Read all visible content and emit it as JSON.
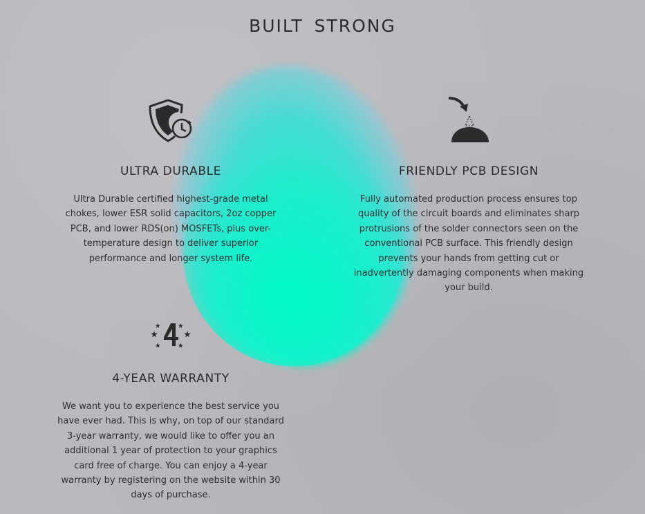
{
  "page": {
    "title": "BUILT STRONG",
    "accent_color": "#00f5c5"
  },
  "features": [
    {
      "icon": "shield-clock-icon",
      "title": "ULTRA DURABLE",
      "description": "Ultra Durable certified highest-grade metal chokes, lower ESR solid capacitors, 2oz copper PCB, and lower RDS(on) MOSFETs, plus over-temperature design to deliver superior performance and longer system life."
    },
    {
      "icon": "pcb-solder-icon",
      "title": "FRIENDLY PCB DESIGN",
      "description": "Fully automated production process ensures top quality of the circuit boards and eliminates sharp protrusions of the solder connectors seen on the conventional PCB surface. This friendly design prevents your hands from getting cut or inadvertently damaging components when making your build."
    },
    {
      "icon": "four-year-warranty-icon",
      "title": "4-YEAR WARRANTY",
      "description": "We want you to experience the best service you have ever had. This is why, on top of our standard 3-year warranty, we would like to offer you an additional 1 year of protection to your graphics card free of charge. You can enjoy a 4-year warranty by registering on the website within 30 days of purchase."
    }
  ]
}
